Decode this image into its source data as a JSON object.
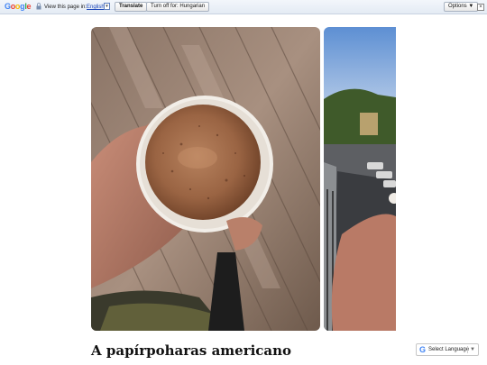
{
  "translate_bar": {
    "logo": [
      "G",
      "o",
      "o",
      "g",
      "l",
      "e"
    ],
    "prompt": "View this page in:",
    "language": "English",
    "translate_label": "Translate",
    "turn_off_label": "Turn off for: Hungarian",
    "options_label": "Options ▼",
    "close_symbol": "×"
  },
  "gallery": {
    "images": [
      {
        "icon": "coffee-cup-photo"
      },
      {
        "icon": "balcony-street-photo"
      }
    ]
  },
  "post": {
    "title": "A papírpoharas americano"
  },
  "language_selector": {
    "label": "Select Language",
    "arrow": "▼"
  },
  "colors": {
    "link": "#1a44b8",
    "bar_bg": "#e4ebf4"
  }
}
